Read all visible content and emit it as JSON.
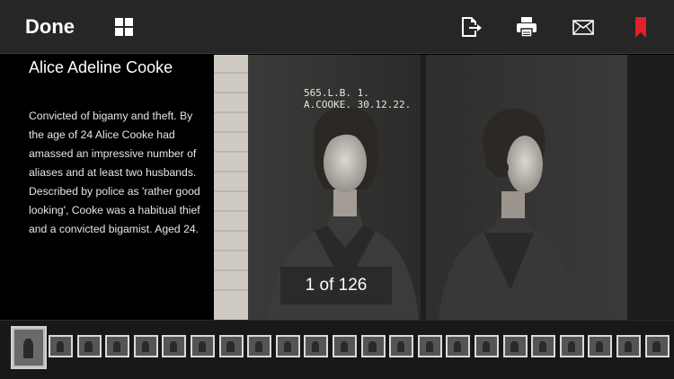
{
  "toolbar": {
    "done_label": "Done",
    "icons": [
      "grid-icon",
      "export-icon",
      "print-icon",
      "mail-icon",
      "bookmark-icon"
    ],
    "bookmark_color": "#e0202a"
  },
  "photo": {
    "title": "Alice Adeline Cooke",
    "description": "Convicted of bigamy and theft. By the age of 24 Alice Cooke had amassed an impressive number of aliases and at least two husbands. Described by police as 'rather good looking', Cooke was a habitual thief and a convicted bigamist. Aged 24.",
    "plate_text_line1": "565.L.B. 1.",
    "plate_text_line2": "A.COOKE. 30.12.22.",
    "counter": "1 of 126"
  },
  "filmstrip": {
    "count": 23,
    "selected_index": 0
  }
}
